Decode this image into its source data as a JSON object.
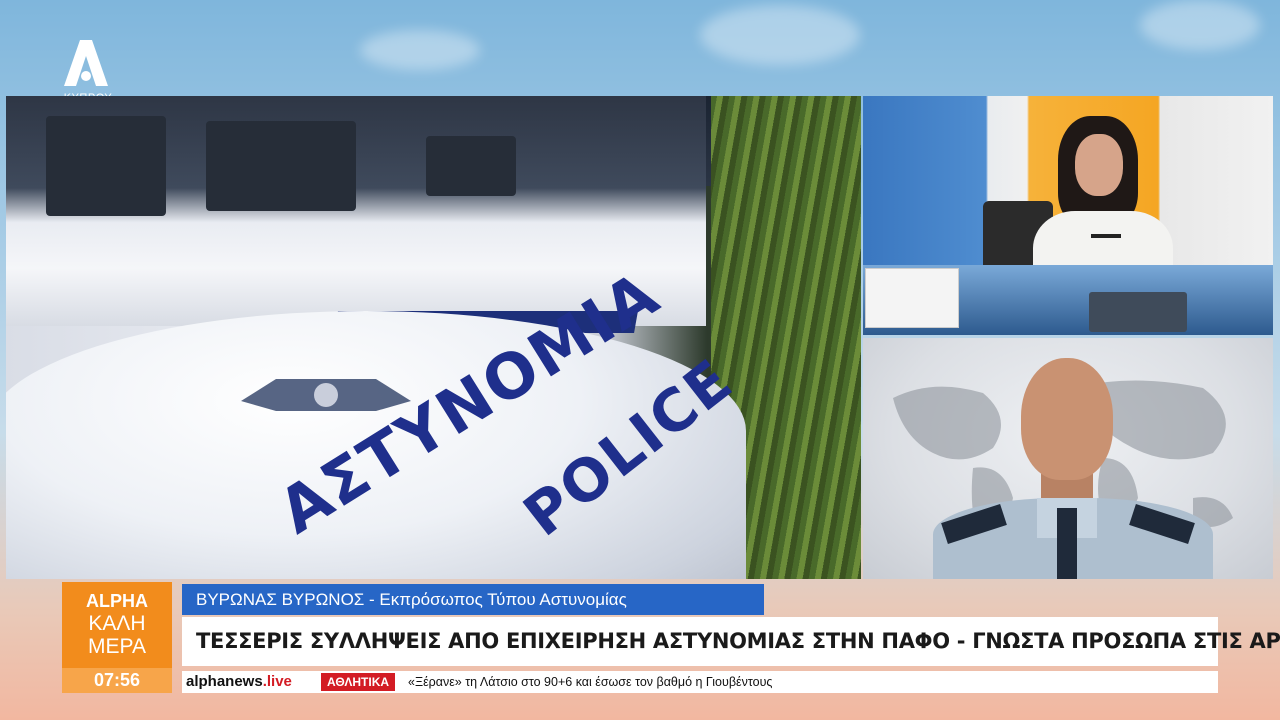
{
  "channel": {
    "logo_label": "ΚΥΠΡΟΥ"
  },
  "show": {
    "line1": "ALPHA",
    "line2": "ΚΑΛΗ",
    "line3": "ΜΕΡΑ",
    "clock": "07:56"
  },
  "main_video": {
    "hood_text_line1": "ΑΣΤΥΝΟΜΙΑ",
    "hood_text_line2": "POLICE"
  },
  "lower_third": {
    "name_title": "ΒΥΡΩΝΑΣ ΒΥΡΩΝΟΣ - Εκπρόσωπος Τύπου Αστυνομίας",
    "headline": "ΤΕΣΣΕΡΙΣ ΣΥΛΛΗΨΕΙΣ ΑΠΟ ΕΠΙΧΕΙΡΗΣΗ ΑΣΤΥΝΟΜΙΑΣ ΣΤΗΝ ΠΑΦΟ - ΓΝΩΣΤΑ ΠΡΟΣΩΠΑ ΣΤΙΣ ΑΡΧΕΣ"
  },
  "ticker": {
    "brand_main": "alphanews",
    "brand_suffix": ".live",
    "category": "ΑΘΛΗΤΙΚΑ",
    "message": "«Ξέρανε» τη Λάτσιο στο 90+6 και έσωσε τον βαθμό η Γιουβέντους"
  },
  "colors": {
    "show_orange": "#f28c1c",
    "name_bar_blue": "#2766c6",
    "ticker_red": "#d31c24"
  }
}
